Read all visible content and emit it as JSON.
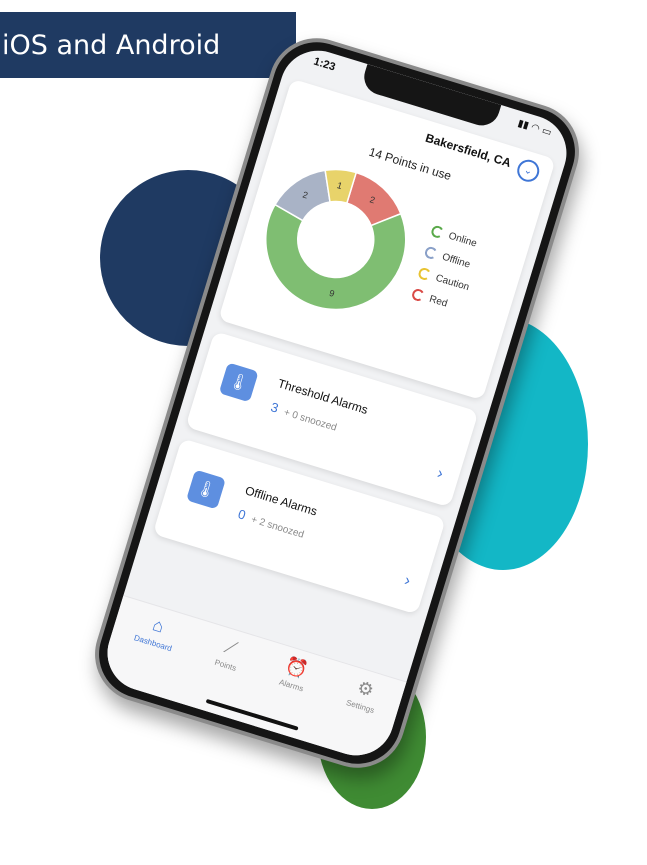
{
  "banner": {
    "text": "iOS and Android"
  },
  "colors": {
    "navy": "#1f3a62",
    "teal": "#13b7c6",
    "green": "#3f8b33",
    "accent": "#3f76d6"
  },
  "status": {
    "time": "1:23",
    "icons": "signal wifi battery"
  },
  "header": {
    "location": "Bakersfield, CA",
    "location_button_icon": "chevron-down-circle-icon"
  },
  "dashboard": {
    "points_title": "14 Points in use",
    "legend": [
      {
        "label": "Online",
        "color": "#5aa94a"
      },
      {
        "label": "Offline",
        "color": "#8aa0c8"
      },
      {
        "label": "Caution",
        "color": "#e8c332"
      },
      {
        "label": "Red",
        "color": "#d94a46"
      }
    ]
  },
  "chart_data": {
    "type": "pie",
    "categories": [
      "Online",
      "Offline",
      "Caution",
      "Red"
    ],
    "values": [
      9,
      2,
      1,
      2
    ],
    "colors": [
      "#7fbe72",
      "#a9b3c6",
      "#e8d36a",
      "#e07a72"
    ]
  },
  "alarms": [
    {
      "title": "Threshold Alarms",
      "count": "3",
      "snoozed": "+ 0 snoozed",
      "icon": "thermometer-icon"
    },
    {
      "title": "Offline Alarms",
      "count": "0",
      "snoozed": "+ 2 snoozed",
      "icon": "thermometer-icon"
    }
  ],
  "tabs": [
    {
      "label": "Dashboard",
      "icon": "home-icon",
      "active": true
    },
    {
      "label": "Points",
      "icon": "chart-icon",
      "active": false
    },
    {
      "label": "Alarms",
      "icon": "alarm-clock-icon",
      "active": false
    },
    {
      "label": "Settings",
      "icon": "gear-icon",
      "active": false
    }
  ]
}
